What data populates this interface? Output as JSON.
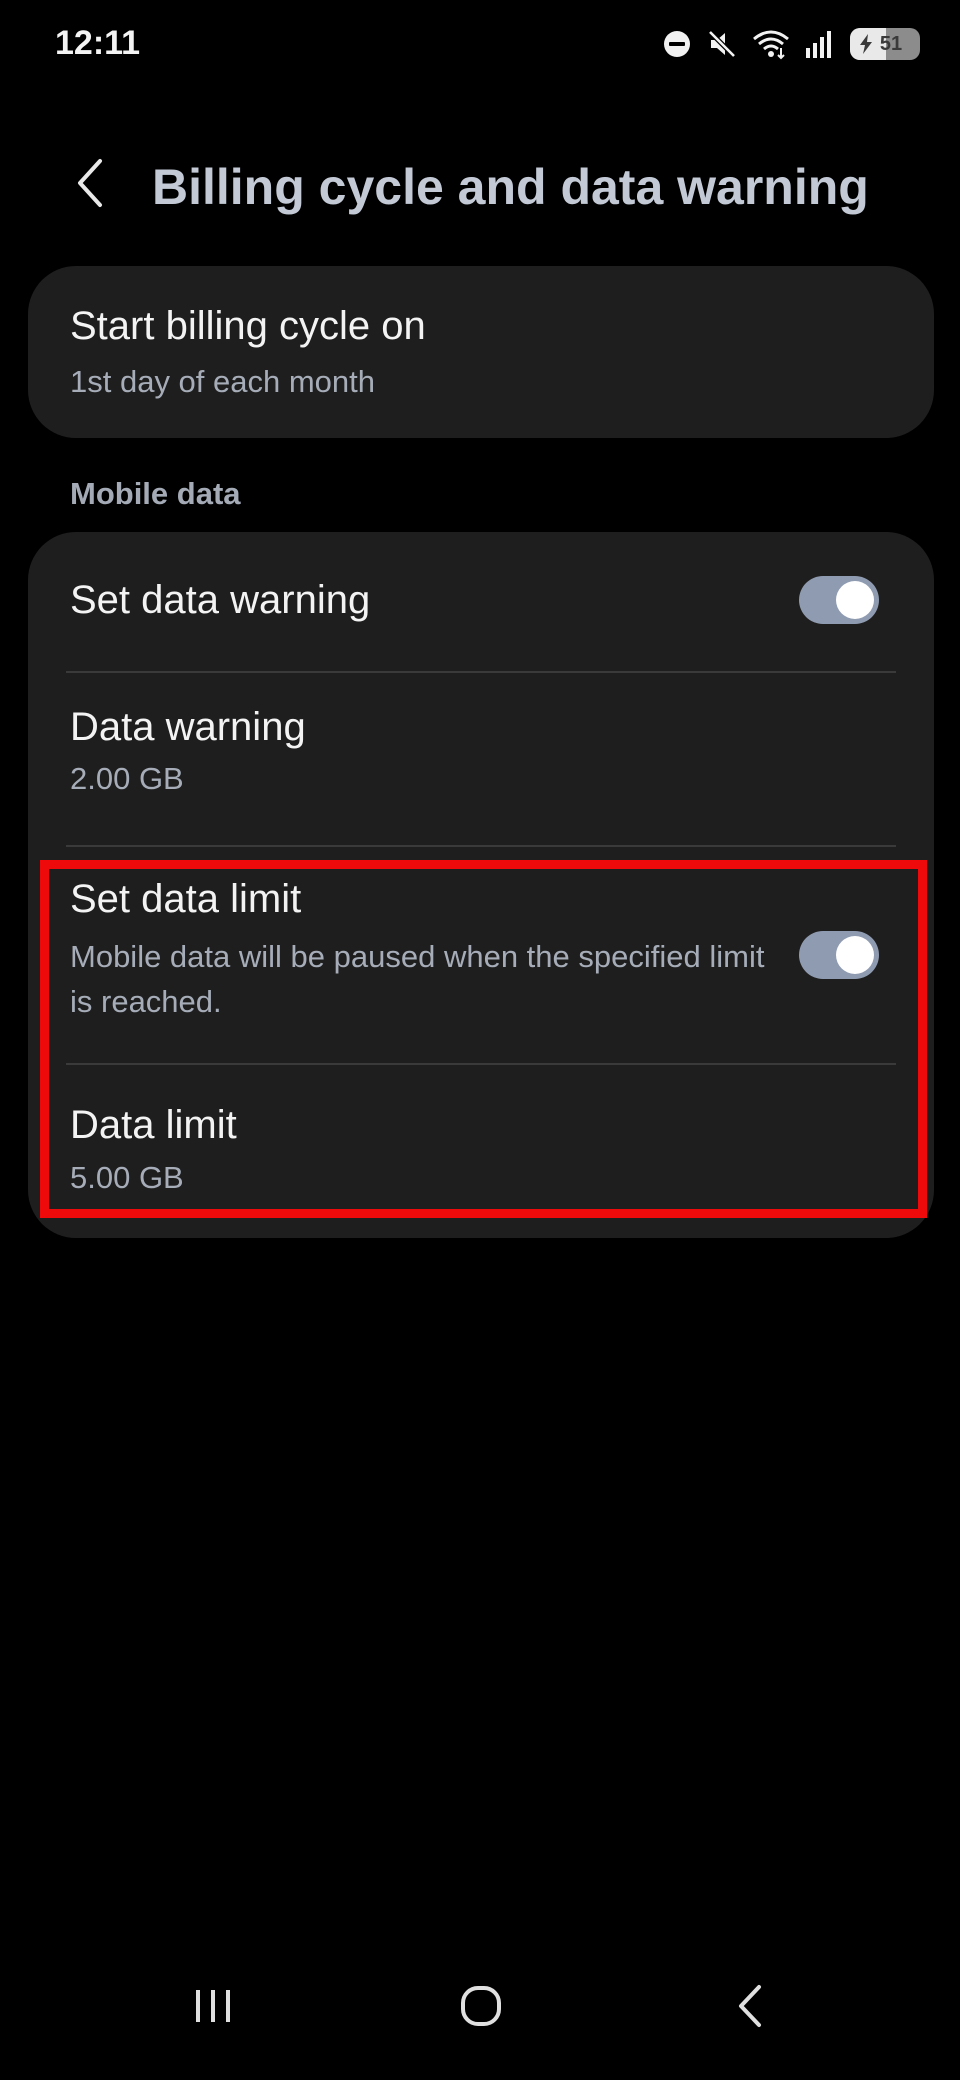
{
  "status_bar": {
    "time": "12:11",
    "battery_level": "51",
    "battery_percent": 51,
    "icons": [
      "do-not-disturb-icon",
      "mute-icon",
      "wifi-icon",
      "signal-icon",
      "battery-icon"
    ]
  },
  "header": {
    "title": "Billing cycle and data warning",
    "back_icon": "chevron-left-icon"
  },
  "billing": {
    "title": "Start billing cycle on",
    "value": "1st day of each month"
  },
  "mobile_data": {
    "section_label": "Mobile data",
    "set_data_warning": {
      "label": "Set data warning",
      "enabled": true
    },
    "data_warning": {
      "label": "Data warning",
      "value": "2.00 GB"
    },
    "set_data_limit": {
      "label": "Set data limit",
      "description": "Mobile data will be paused when the specified limit is reached.",
      "enabled": true
    },
    "data_limit": {
      "label": "Data limit",
      "value": "5.00 GB"
    }
  },
  "colors": {
    "background": "#000000",
    "card": "#1e1e1e",
    "title": "#c3cad6",
    "subtext": "#a6adb8",
    "toggle_on": "#8f9bb0",
    "highlight": "#ee0a0a"
  },
  "nav_bar": {
    "icons": [
      "recent-apps-icon",
      "home-icon",
      "back-icon"
    ]
  }
}
